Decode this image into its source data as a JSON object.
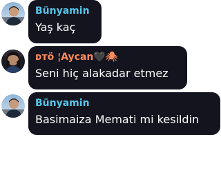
{
  "messages": [
    {
      "author": "Bünyamin",
      "text": "Yaş kaç",
      "author_color": "#55c4e7"
    },
    {
      "author": "ᴅᴛö ¦Aycan🖤🕷",
      "text": "Seni hiç alakadar etmez",
      "author_color": "#ff8c5a"
    },
    {
      "author": "Bünyamin",
      "text": "Basimaiza Memati mi kesildin",
      "author_color": "#55c4e7"
    }
  ],
  "colors": {
    "bubble_background": "#14141f",
    "message_text": "#ffffff",
    "page_background": "#ffffff"
  },
  "icons": {
    "avatar_1": "user-avatar-icon",
    "avatar_2": "user-avatar-icon",
    "avatar_3": "user-avatar-icon"
  }
}
